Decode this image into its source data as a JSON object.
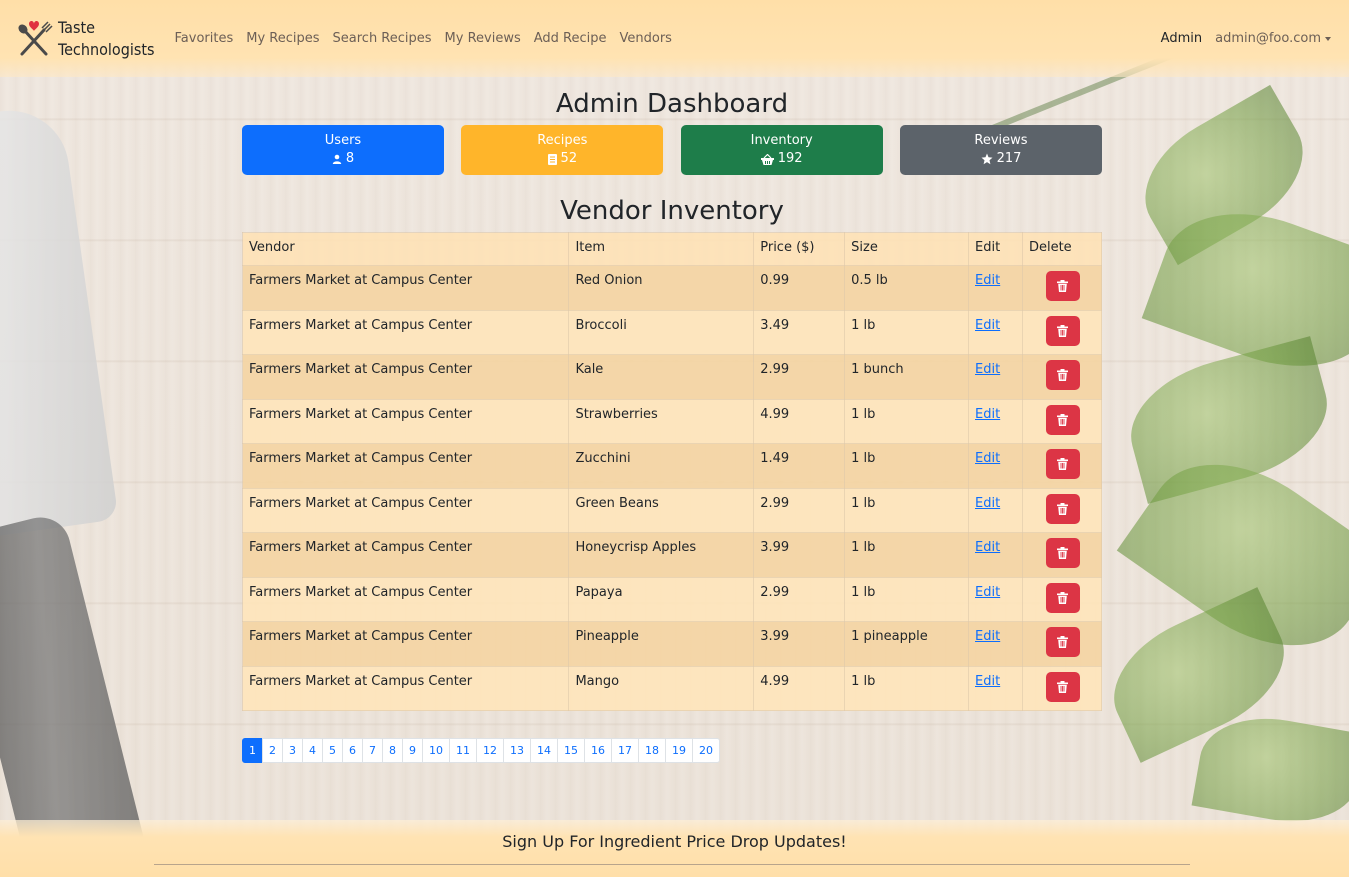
{
  "brand": {
    "line1": "Taste",
    "line2": "Technologists"
  },
  "nav": {
    "links": [
      "Favorites",
      "My Recipes",
      "Search Recipes",
      "My Reviews",
      "Add Recipe",
      "Vendors"
    ],
    "admin": "Admin",
    "user": "admin@foo.com"
  },
  "dashboard": {
    "title": "Admin Dashboard",
    "cards": [
      {
        "label": "Users",
        "value": "8",
        "icon": "user-icon",
        "color": "#0d6efd"
      },
      {
        "label": "Recipes",
        "value": "52",
        "icon": "document-icon",
        "color": "#ffb52a"
      },
      {
        "label": "Inventory",
        "value": "192",
        "icon": "basket-icon",
        "color": "#1e7d4a"
      },
      {
        "label": "Reviews",
        "value": "217",
        "icon": "star-icon",
        "color": "#5c636a"
      }
    ]
  },
  "inventory": {
    "title": "Vendor Inventory",
    "columns": [
      "Vendor",
      "Item",
      "Price ($)",
      "Size",
      "Edit",
      "Delete"
    ],
    "edit_label": "Edit",
    "rows": [
      {
        "vendor": "Farmers Market at Campus Center",
        "item": "Red Onion",
        "price": "0.99",
        "size": "0.5 lb"
      },
      {
        "vendor": "Farmers Market at Campus Center",
        "item": "Broccoli",
        "price": "3.49",
        "size": "1 lb"
      },
      {
        "vendor": "Farmers Market at Campus Center",
        "item": "Kale",
        "price": "2.99",
        "size": "1 bunch"
      },
      {
        "vendor": "Farmers Market at Campus Center",
        "item": "Strawberries",
        "price": "4.99",
        "size": "1 lb"
      },
      {
        "vendor": "Farmers Market at Campus Center",
        "item": "Zucchini",
        "price": "1.49",
        "size": "1 lb"
      },
      {
        "vendor": "Farmers Market at Campus Center",
        "item": "Green Beans",
        "price": "2.99",
        "size": "1 lb"
      },
      {
        "vendor": "Farmers Market at Campus Center",
        "item": "Honeycrisp Apples",
        "price": "3.99",
        "size": "1 lb"
      },
      {
        "vendor": "Farmers Market at Campus Center",
        "item": "Papaya",
        "price": "2.99",
        "size": "1 lb"
      },
      {
        "vendor": "Farmers Market at Campus Center",
        "item": "Pineapple",
        "price": "3.99",
        "size": "1 pineapple"
      },
      {
        "vendor": "Farmers Market at Campus Center",
        "item": "Mango",
        "price": "4.99",
        "size": "1 lb"
      }
    ]
  },
  "pagination": {
    "current": "1",
    "pages": [
      "1",
      "2",
      "3",
      "4",
      "5",
      "6",
      "7",
      "8",
      "9",
      "10",
      "11",
      "12",
      "13",
      "14",
      "15",
      "16",
      "17",
      "18",
      "19",
      "20"
    ]
  },
  "footer": {
    "text": "Sign Up For Ingredient Price Drop Updates!"
  },
  "colors": {
    "navbar": "#ffe0aa",
    "danger": "#dc3545",
    "primary": "#0d6efd"
  }
}
